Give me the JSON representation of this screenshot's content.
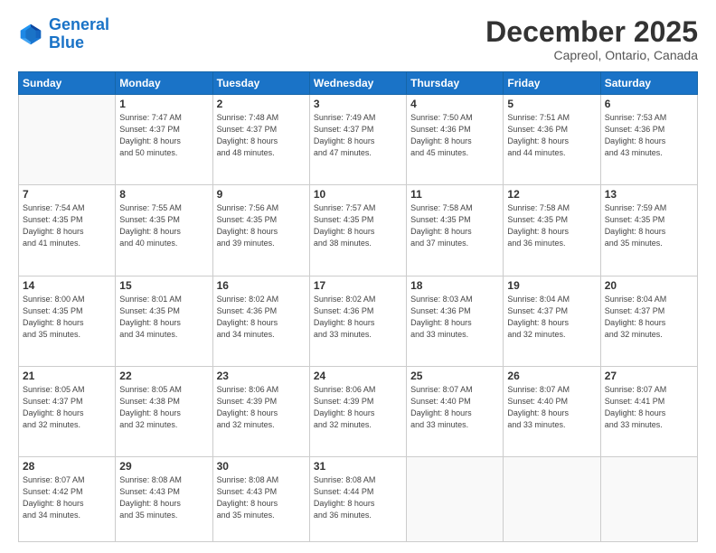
{
  "header": {
    "logo_line1": "General",
    "logo_line2": "Blue",
    "month": "December 2025",
    "location": "Capreol, Ontario, Canada"
  },
  "days_of_week": [
    "Sunday",
    "Monday",
    "Tuesday",
    "Wednesday",
    "Thursday",
    "Friday",
    "Saturday"
  ],
  "weeks": [
    [
      {
        "day": "",
        "info": ""
      },
      {
        "day": "1",
        "info": "Sunrise: 7:47 AM\nSunset: 4:37 PM\nDaylight: 8 hours\nand 50 minutes."
      },
      {
        "day": "2",
        "info": "Sunrise: 7:48 AM\nSunset: 4:37 PM\nDaylight: 8 hours\nand 48 minutes."
      },
      {
        "day": "3",
        "info": "Sunrise: 7:49 AM\nSunset: 4:37 PM\nDaylight: 8 hours\nand 47 minutes."
      },
      {
        "day": "4",
        "info": "Sunrise: 7:50 AM\nSunset: 4:36 PM\nDaylight: 8 hours\nand 45 minutes."
      },
      {
        "day": "5",
        "info": "Sunrise: 7:51 AM\nSunset: 4:36 PM\nDaylight: 8 hours\nand 44 minutes."
      },
      {
        "day": "6",
        "info": "Sunrise: 7:53 AM\nSunset: 4:36 PM\nDaylight: 8 hours\nand 43 minutes."
      }
    ],
    [
      {
        "day": "7",
        "info": "Sunrise: 7:54 AM\nSunset: 4:35 PM\nDaylight: 8 hours\nand 41 minutes."
      },
      {
        "day": "8",
        "info": "Sunrise: 7:55 AM\nSunset: 4:35 PM\nDaylight: 8 hours\nand 40 minutes."
      },
      {
        "day": "9",
        "info": "Sunrise: 7:56 AM\nSunset: 4:35 PM\nDaylight: 8 hours\nand 39 minutes."
      },
      {
        "day": "10",
        "info": "Sunrise: 7:57 AM\nSunset: 4:35 PM\nDaylight: 8 hours\nand 38 minutes."
      },
      {
        "day": "11",
        "info": "Sunrise: 7:58 AM\nSunset: 4:35 PM\nDaylight: 8 hours\nand 37 minutes."
      },
      {
        "day": "12",
        "info": "Sunrise: 7:58 AM\nSunset: 4:35 PM\nDaylight: 8 hours\nand 36 minutes."
      },
      {
        "day": "13",
        "info": "Sunrise: 7:59 AM\nSunset: 4:35 PM\nDaylight: 8 hours\nand 35 minutes."
      }
    ],
    [
      {
        "day": "14",
        "info": "Sunrise: 8:00 AM\nSunset: 4:35 PM\nDaylight: 8 hours\nand 35 minutes."
      },
      {
        "day": "15",
        "info": "Sunrise: 8:01 AM\nSunset: 4:35 PM\nDaylight: 8 hours\nand 34 minutes."
      },
      {
        "day": "16",
        "info": "Sunrise: 8:02 AM\nSunset: 4:36 PM\nDaylight: 8 hours\nand 34 minutes."
      },
      {
        "day": "17",
        "info": "Sunrise: 8:02 AM\nSunset: 4:36 PM\nDaylight: 8 hours\nand 33 minutes."
      },
      {
        "day": "18",
        "info": "Sunrise: 8:03 AM\nSunset: 4:36 PM\nDaylight: 8 hours\nand 33 minutes."
      },
      {
        "day": "19",
        "info": "Sunrise: 8:04 AM\nSunset: 4:37 PM\nDaylight: 8 hours\nand 32 minutes."
      },
      {
        "day": "20",
        "info": "Sunrise: 8:04 AM\nSunset: 4:37 PM\nDaylight: 8 hours\nand 32 minutes."
      }
    ],
    [
      {
        "day": "21",
        "info": "Sunrise: 8:05 AM\nSunset: 4:37 PM\nDaylight: 8 hours\nand 32 minutes."
      },
      {
        "day": "22",
        "info": "Sunrise: 8:05 AM\nSunset: 4:38 PM\nDaylight: 8 hours\nand 32 minutes."
      },
      {
        "day": "23",
        "info": "Sunrise: 8:06 AM\nSunset: 4:39 PM\nDaylight: 8 hours\nand 32 minutes."
      },
      {
        "day": "24",
        "info": "Sunrise: 8:06 AM\nSunset: 4:39 PM\nDaylight: 8 hours\nand 32 minutes."
      },
      {
        "day": "25",
        "info": "Sunrise: 8:07 AM\nSunset: 4:40 PM\nDaylight: 8 hours\nand 33 minutes."
      },
      {
        "day": "26",
        "info": "Sunrise: 8:07 AM\nSunset: 4:40 PM\nDaylight: 8 hours\nand 33 minutes."
      },
      {
        "day": "27",
        "info": "Sunrise: 8:07 AM\nSunset: 4:41 PM\nDaylight: 8 hours\nand 33 minutes."
      }
    ],
    [
      {
        "day": "28",
        "info": "Sunrise: 8:07 AM\nSunset: 4:42 PM\nDaylight: 8 hours\nand 34 minutes."
      },
      {
        "day": "29",
        "info": "Sunrise: 8:08 AM\nSunset: 4:43 PM\nDaylight: 8 hours\nand 35 minutes."
      },
      {
        "day": "30",
        "info": "Sunrise: 8:08 AM\nSunset: 4:43 PM\nDaylight: 8 hours\nand 35 minutes."
      },
      {
        "day": "31",
        "info": "Sunrise: 8:08 AM\nSunset: 4:44 PM\nDaylight: 8 hours\nand 36 minutes."
      },
      {
        "day": "",
        "info": ""
      },
      {
        "day": "",
        "info": ""
      },
      {
        "day": "",
        "info": ""
      }
    ]
  ]
}
